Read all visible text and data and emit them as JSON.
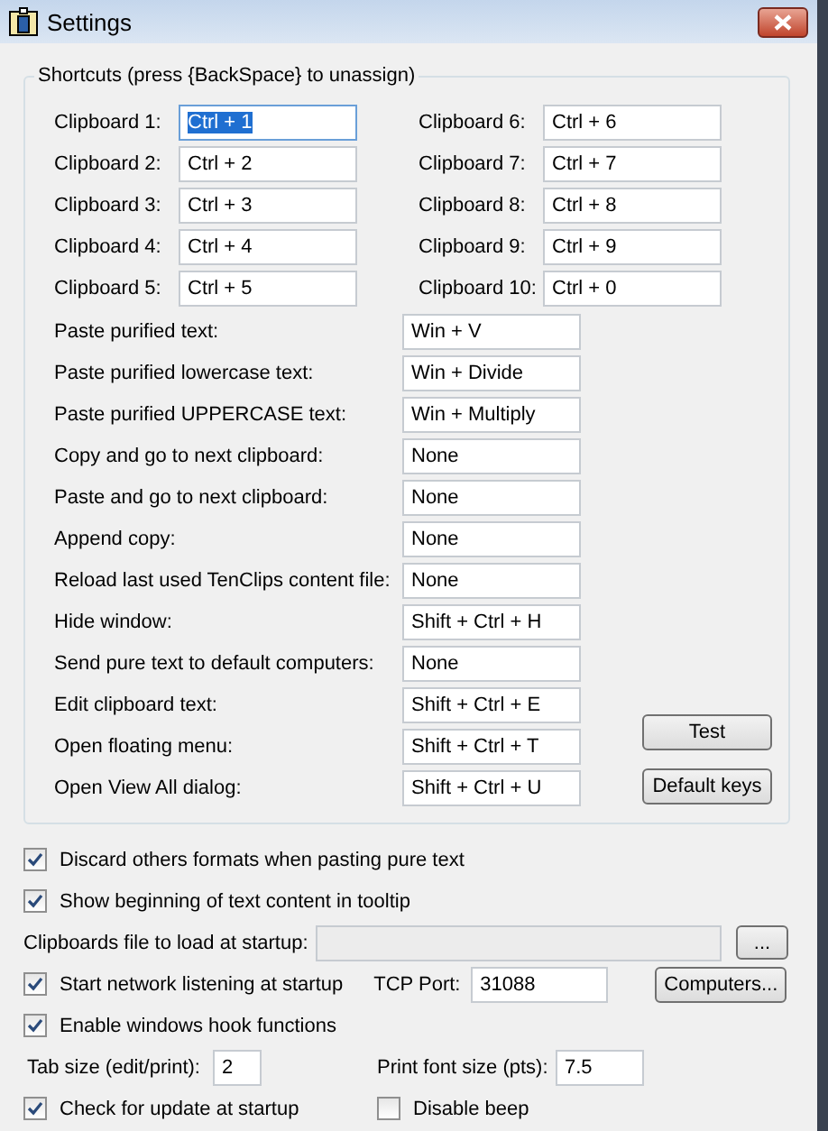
{
  "window": {
    "title": "Settings"
  },
  "shortcuts": {
    "legend": "Shortcuts (press {BackSpace} to unassign)",
    "clipboards": [
      {
        "label": "Clipboard 1:",
        "value": "Ctrl + 1",
        "selected": true
      },
      {
        "label": "Clipboard 2:",
        "value": "Ctrl + 2",
        "selected": false
      },
      {
        "label": "Clipboard 3:",
        "value": "Ctrl + 3",
        "selected": false
      },
      {
        "label": "Clipboard 4:",
        "value": "Ctrl + 4",
        "selected": false
      },
      {
        "label": "Clipboard 5:",
        "value": "Ctrl + 5",
        "selected": false
      },
      {
        "label": "Clipboard 6:",
        "value": "Ctrl + 6",
        "selected": false
      },
      {
        "label": "Clipboard 7:",
        "value": "Ctrl + 7",
        "selected": false
      },
      {
        "label": "Clipboard 8:",
        "value": "Ctrl + 8",
        "selected": false
      },
      {
        "label": "Clipboard 9:",
        "value": "Ctrl + 9",
        "selected": false
      },
      {
        "label": "Clipboard 10:",
        "value": "Ctrl + 0",
        "selected": false
      }
    ],
    "actions": [
      {
        "label": "Paste purified text:",
        "value": "Win + V"
      },
      {
        "label": "Paste purified lowercase text:",
        "value": "Win + Divide"
      },
      {
        "label": "Paste purified UPPERCASE text:",
        "value": "Win + Multiply"
      },
      {
        "label": "Copy and go to next clipboard:",
        "value": "None"
      },
      {
        "label": "Paste and go to next clipboard:",
        "value": "None"
      },
      {
        "label": "Append copy:",
        "value": "None"
      },
      {
        "label": "Reload last used TenClips content file:",
        "value": "None"
      },
      {
        "label": "Hide window:",
        "value": "Shift + Ctrl + H"
      },
      {
        "label": "Send pure text to default computers:",
        "value": "None"
      },
      {
        "label": "Edit clipboard text:",
        "value": "Shift + Ctrl + E"
      },
      {
        "label": "Open floating menu:",
        "value": "Shift + Ctrl + T"
      },
      {
        "label": "Open View All dialog:",
        "value": "Shift + Ctrl + U"
      }
    ],
    "buttons": [
      "Test",
      "Default keys"
    ]
  },
  "discard_formats": {
    "label": "Discard others formats when pasting pure text",
    "checked": true
  },
  "show_tooltip": {
    "label": "Show beginning of text content in tooltip",
    "checked": true
  },
  "startup_file": {
    "label": "Clipboards file to load at startup:",
    "disabled": true,
    "button": "..."
  },
  "network": {
    "label": "Start network listening at startup",
    "checked": true
  },
  "tcp_port": {
    "label": "TCP Port:",
    "value": "31088",
    "button": "Computers..."
  },
  "hook": {
    "label": "Enable windows hook functions",
    "checked": true
  },
  "tab_size": {
    "label": "Tab size (edit/print):",
    "value": "2"
  },
  "print_font_size": {
    "label": "Print font size (pts):",
    "value": "7.5"
  },
  "check_update": {
    "label": "Check for update at startup",
    "checked": true
  },
  "disable_beep": {
    "label": "Disable beep",
    "checked": false
  }
}
